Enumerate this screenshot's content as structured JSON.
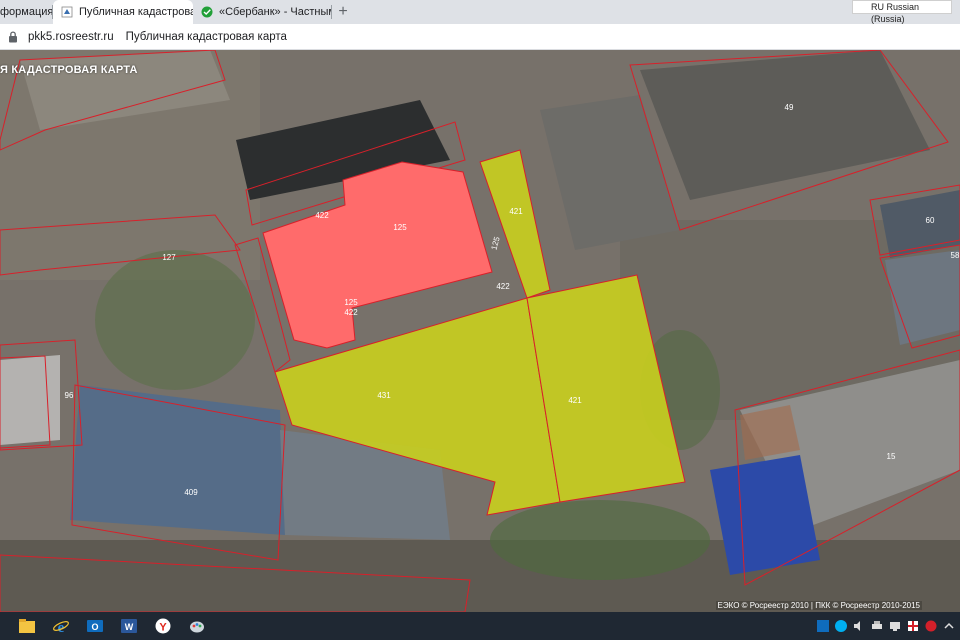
{
  "browser": {
    "tabs": [
      {
        "label": "формация",
        "active": false
      },
      {
        "label": "Публичная кадастровая",
        "active": true
      },
      {
        "label": "«Сбербанк» - Частным",
        "active": false
      }
    ],
    "tab_close_glyph": "✕",
    "tab_dot_glyph": "●",
    "new_tab_glyph": "+",
    "language_indicator": "RU Russian (Russia)",
    "address": {
      "host": "pkk5.rosreestr.ru",
      "page_title": "Публичная кадастровая карта"
    }
  },
  "map": {
    "title": "Я КАДАСТРОВАЯ КАРТА",
    "parcel_labels": [
      {
        "id": "49",
        "text": "49"
      },
      {
        "id": "422-top",
        "text": "422"
      },
      {
        "id": "125-center",
        "text": "125"
      },
      {
        "id": "125-side",
        "text": "125"
      },
      {
        "id": "421-top",
        "text": "421"
      },
      {
        "id": "422-right",
        "text": "422"
      },
      {
        "id": "125-bottom",
        "text": "125"
      },
      {
        "id": "422-bottom",
        "text": "422"
      },
      {
        "id": "127",
        "text": "127"
      },
      {
        "id": "60",
        "text": "60"
      },
      {
        "id": "58",
        "text": "58"
      },
      {
        "id": "96",
        "text": "96"
      },
      {
        "id": "431",
        "text": "431"
      },
      {
        "id": "421-main",
        "text": "421"
      },
      {
        "id": "409",
        "text": "409"
      },
      {
        "id": "15",
        "text": "15"
      }
    ],
    "attribution": "ЕЭКО © Росреестр 2010 | ПКК © Росреестр 2010-2015",
    "colors": {
      "selected_parcel_red": "#ff6b6b",
      "selected_parcel_yellow": "#c9cf1e",
      "parcel_border": "#d8202a"
    }
  },
  "taskbar": {
    "apps": [
      "file-explorer",
      "internet-explorer",
      "outlook",
      "word",
      "yandex-browser",
      "paint"
    ],
    "tray_icons": [
      "outlook-tray",
      "skype",
      "volume",
      "printer",
      "network",
      "flag",
      "antivirus",
      "chevron"
    ]
  }
}
